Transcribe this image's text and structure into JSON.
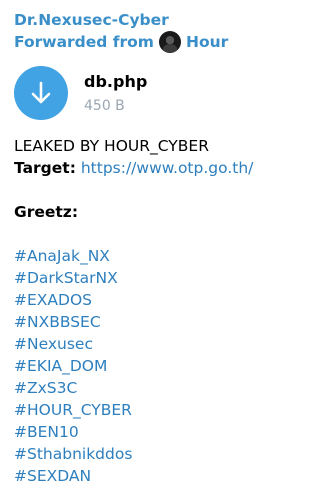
{
  "message": {
    "sender": "Dr.Nexusec-Cyber",
    "forwarded_prefix": "Forwarded from",
    "forwarded_name": "Hour",
    "file": {
      "icon": "download-arrow-icon",
      "name": "db.php",
      "size": "450 B"
    },
    "body": {
      "headline": "LEAKED BY HOUR_CYBER",
      "target_label": "Target:",
      "target_url": "https://www.otp.go.th/",
      "greetz_label": "Greetz:",
      "hashtags": [
        "#AnaJak_NX",
        "#DarkStarNX",
        "#EXADOS",
        "#NXBBSEC",
        "#Nexusec",
        "#EKIA_DOM",
        "#ZxS3C",
        "#HOUR_CYBER",
        "#BEN10",
        "#Sthabnikddos",
        "#SEXDAN"
      ]
    }
  },
  "colors": {
    "accent": "#3a8fc9",
    "link": "#2e7fbe",
    "file_button": "#41a3e3",
    "muted": "#9aa6b2"
  }
}
